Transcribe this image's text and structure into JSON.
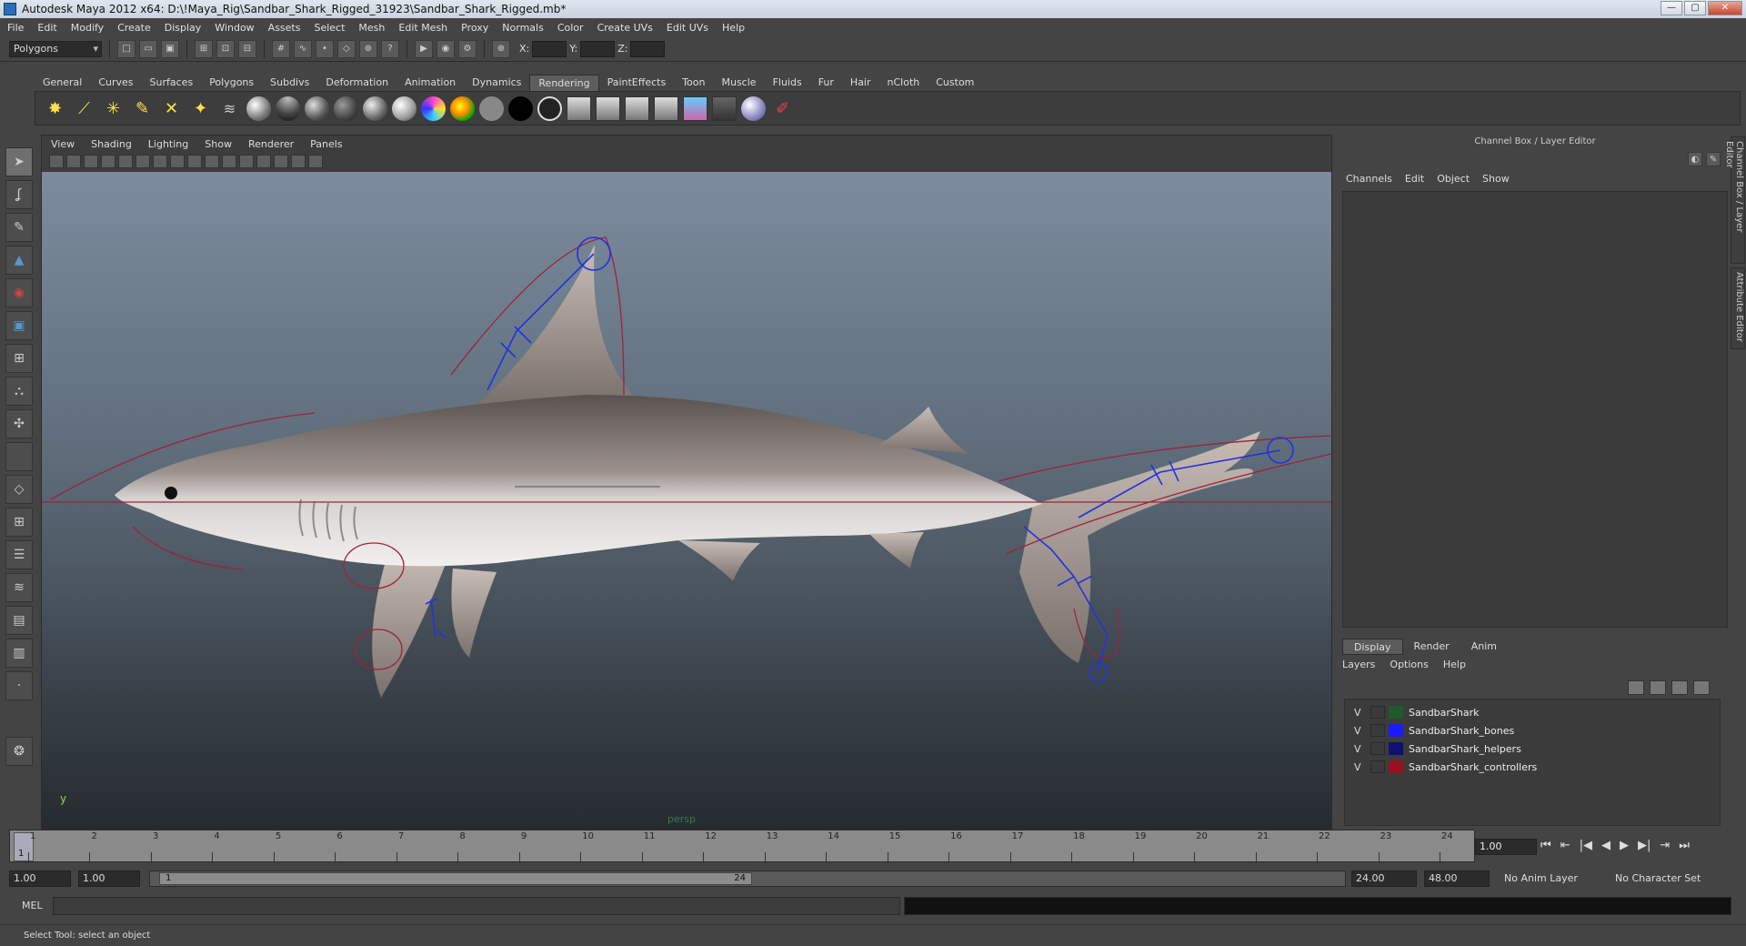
{
  "window": {
    "title": "Autodesk Maya 2012 x64: D:\\!Maya_Rig\\Sandbar_Shark_Rigged_31923\\Sandbar_Shark_Rigged.mb*",
    "minimize": "—",
    "maximize": "▢",
    "close": "✕"
  },
  "menubar": [
    "File",
    "Edit",
    "Modify",
    "Create",
    "Display",
    "Window",
    "Assets",
    "Select",
    "Mesh",
    "Edit Mesh",
    "Proxy",
    "Normals",
    "Color",
    "Create UVs",
    "Edit UVs",
    "Help"
  ],
  "statusline": {
    "mode": "Polygons",
    "x_label": "X:",
    "y_label": "Y:",
    "z_label": "Z:"
  },
  "shelf": {
    "tabs": [
      "General",
      "Curves",
      "Surfaces",
      "Polygons",
      "Subdivs",
      "Deformation",
      "Animation",
      "Dynamics",
      "Rendering",
      "PaintEffects",
      "Toon",
      "Muscle",
      "Fluids",
      "Fur",
      "Hair",
      "nCloth",
      "Custom"
    ],
    "active_tab": "Rendering"
  },
  "viewport": {
    "menu": [
      "View",
      "Shading",
      "Lighting",
      "Show",
      "Renderer",
      "Panels"
    ],
    "camera": "persp",
    "axis_y": "y"
  },
  "channel_box": {
    "title": "Channel Box / Layer Editor",
    "menu": [
      "Channels",
      "Edit",
      "Object",
      "Show"
    ],
    "side_tabs": [
      "Channel Box / Layer Editor",
      "Attribute Editor"
    ]
  },
  "layer_editor": {
    "tabs": [
      "Display",
      "Render",
      "Anim"
    ],
    "active_tab": "Display",
    "menu": [
      "Layers",
      "Options",
      "Help"
    ],
    "layers": [
      {
        "visible": "V",
        "name": "SandbarShark",
        "color": "#1f5a2a"
      },
      {
        "visible": "V",
        "name": "SandbarShark_bones",
        "color": "#1a1aff"
      },
      {
        "visible": "V",
        "name": "SandbarShark_helpers",
        "color": "#101070"
      },
      {
        "visible": "V",
        "name": "SandbarShark_controllers",
        "color": "#9a1020"
      }
    ]
  },
  "timeline": {
    "ticks": [
      "1",
      "2",
      "3",
      "4",
      "5",
      "6",
      "7",
      "8",
      "9",
      "10",
      "11",
      "12",
      "13",
      "14",
      "15",
      "16",
      "17",
      "18",
      "19",
      "20",
      "21",
      "22",
      "23",
      "24"
    ],
    "current_frame_marker": "1",
    "current_frame": "1.00"
  },
  "range": {
    "start": "1.00",
    "playback_start": "1.00",
    "handle_start": "1",
    "handle_end": "24",
    "playback_end": "24.00",
    "end": "48.00",
    "anim_layer": "No Anim Layer",
    "character_set": "No Character Set"
  },
  "command": {
    "label": "MEL"
  },
  "help_line": "Select Tool: select an object"
}
